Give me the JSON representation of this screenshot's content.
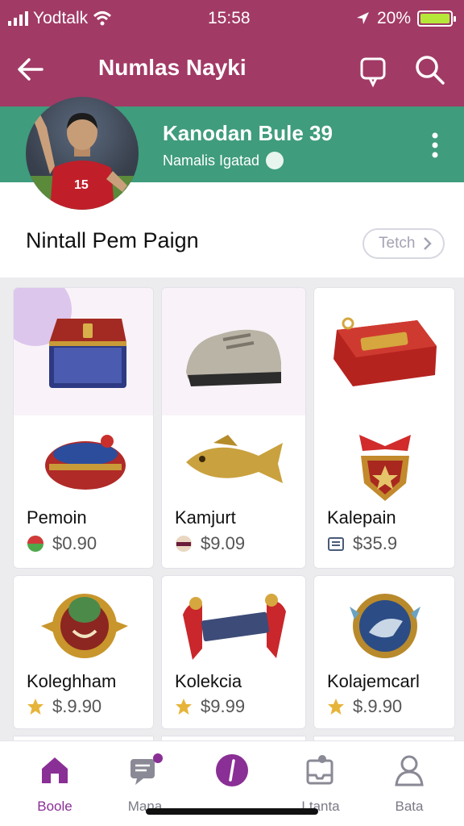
{
  "status_bar": {
    "carrier": "Yodtalk",
    "time": "15:58",
    "battery_percent": "20%"
  },
  "app_bar": {
    "title": "Numlas Nayki"
  },
  "profile": {
    "name": "Kanodan Bule 39",
    "subtitle": "Namalis Igatad",
    "jersey_number": "15"
  },
  "section": {
    "heading": "Nintall Pem Paign",
    "action_label": "Tetch"
  },
  "items": [
    {
      "label": "",
      "price": ""
    },
    {
      "label": "",
      "price": ""
    },
    {
      "label": "",
      "price": ""
    },
    {
      "label": "Pemoin",
      "price": "$0.90"
    },
    {
      "label": "Kamjurt",
      "price": "$9.09"
    },
    {
      "label": "Kalepain",
      "price": "$35.9"
    },
    {
      "label": "Koleghham",
      "price": "$.9.90"
    },
    {
      "label": "Kolekcia",
      "price": "$9.99"
    },
    {
      "label": "Kolajemcarl",
      "price": "$.9.90"
    }
  ],
  "bottom_nav": [
    {
      "label": "Boole",
      "icon": "home-icon",
      "active": true
    },
    {
      "label": "Mana",
      "icon": "chat-icon",
      "active": false
    },
    {
      "label": "",
      "icon": "compass-icon",
      "active": false
    },
    {
      "label": "Ltanta",
      "icon": "inbox-icon",
      "active": false
    },
    {
      "label": "Bata",
      "icon": "profile-icon",
      "active": false
    }
  ],
  "colors": {
    "primary": "#a23a66",
    "profile_band": "#3f9c7c",
    "accent": "#8a2f95",
    "battery": "#b6e83a"
  }
}
